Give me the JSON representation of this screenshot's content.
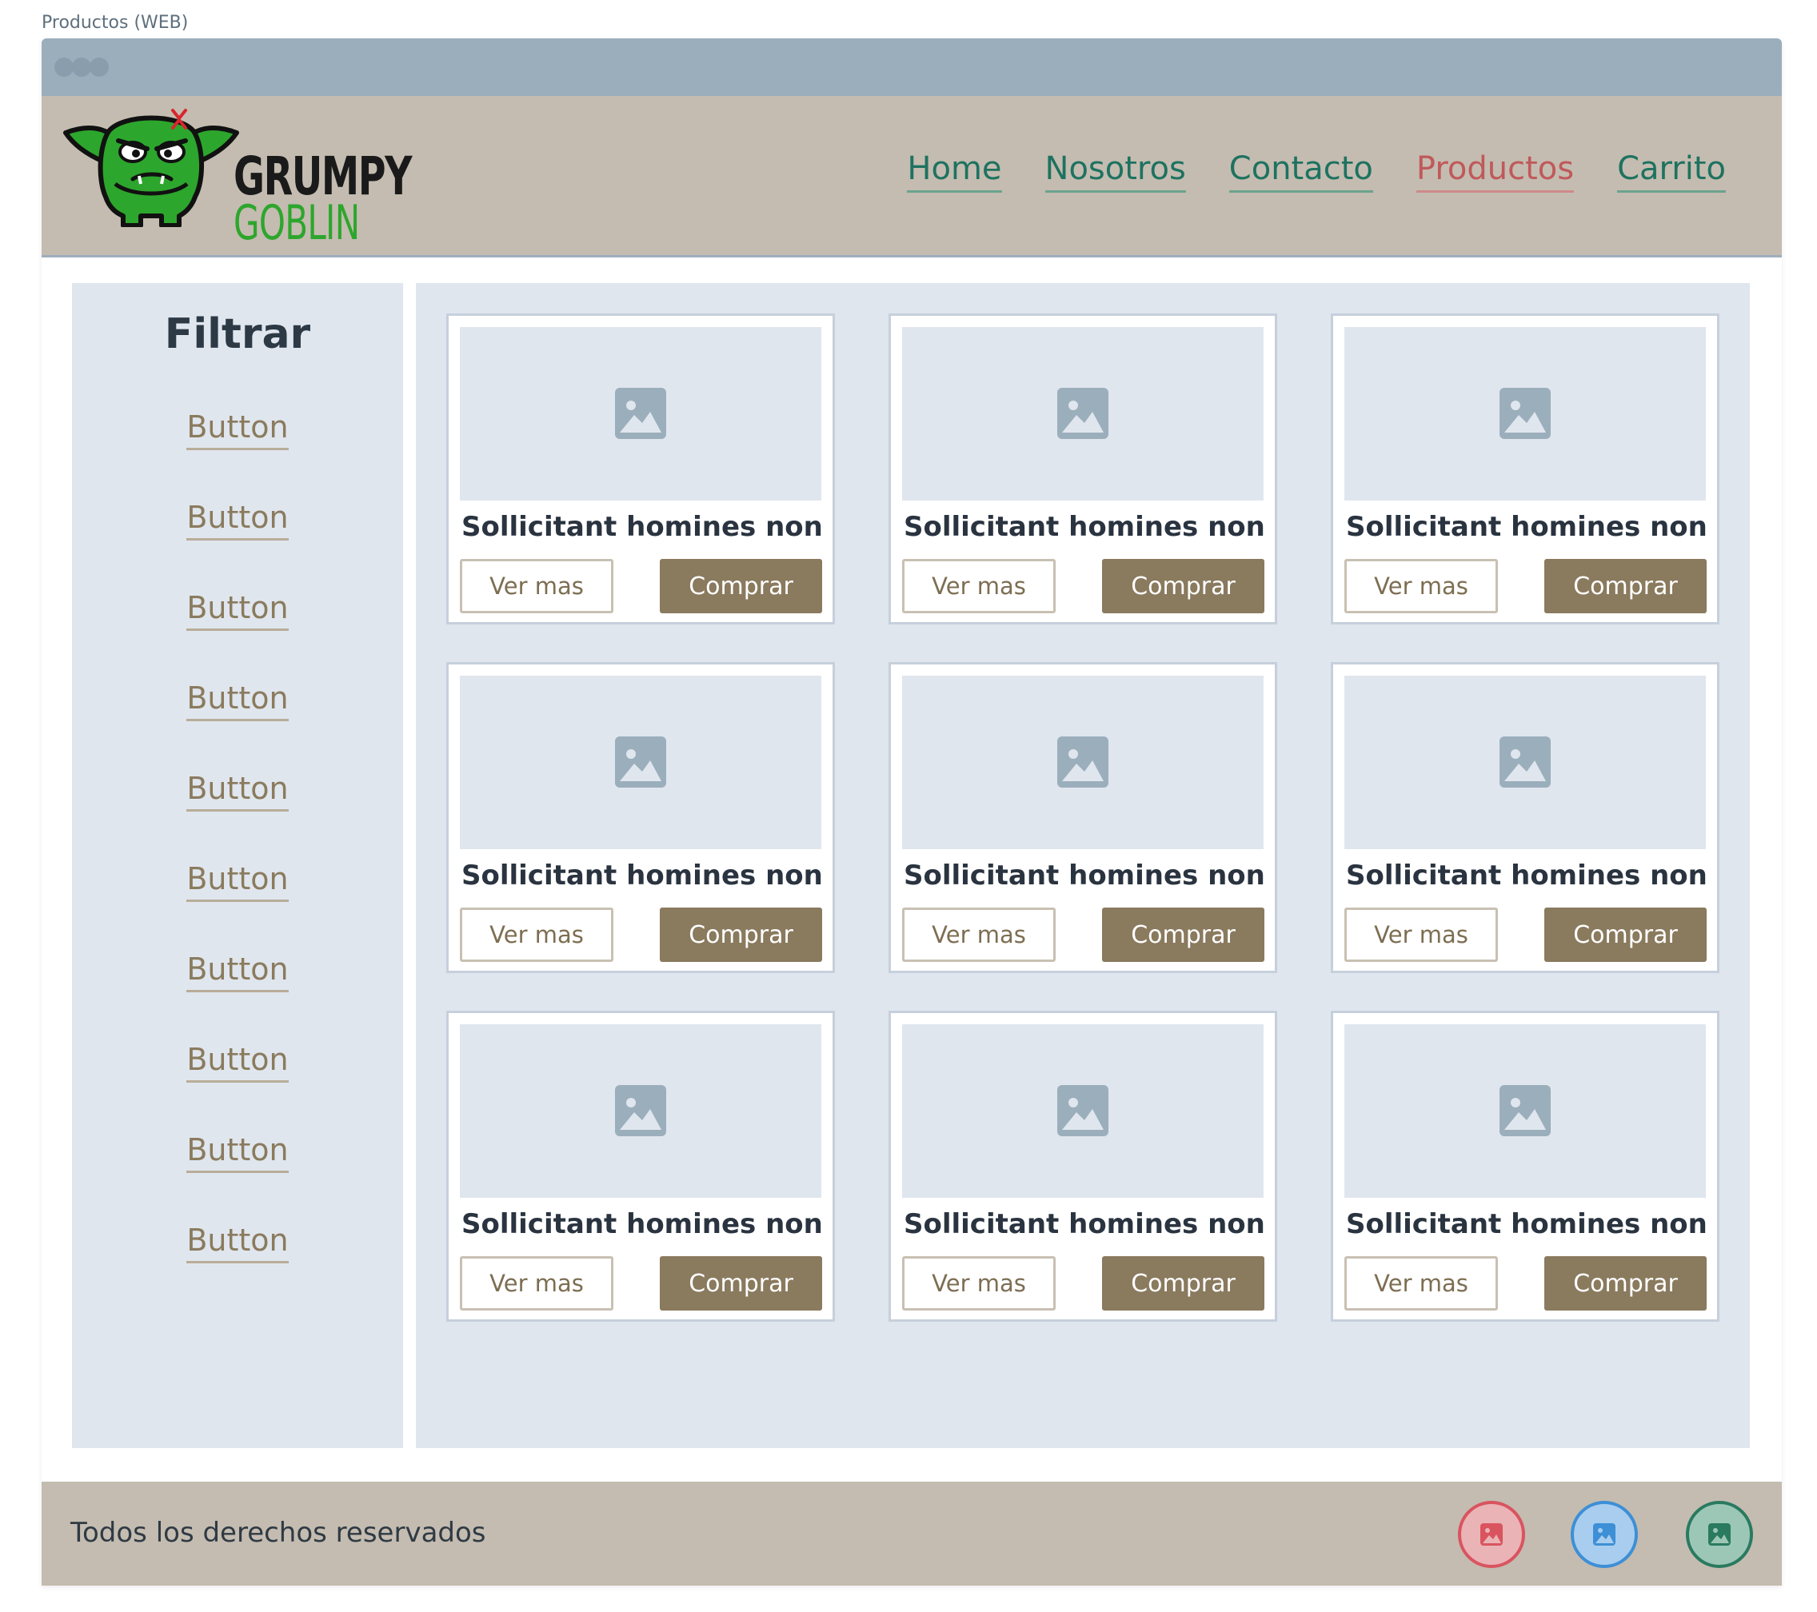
{
  "page_label": "Productos (WEB)",
  "logo": {
    "line1": "GRUMPY",
    "line2": "GOBLIN"
  },
  "nav": {
    "items": [
      {
        "label": "Home"
      },
      {
        "label": "Nosotros"
      },
      {
        "label": "Contacto"
      },
      {
        "label": "Productos",
        "active": true
      },
      {
        "label": "Carrito"
      }
    ]
  },
  "sidebar": {
    "title": "Filtrar",
    "buttons": [
      "Button",
      "Button",
      "Button",
      "Button",
      "Button",
      "Button",
      "Button",
      "Button",
      "Button",
      "Button"
    ]
  },
  "products": [
    {
      "title": "Sollicitant homines non",
      "view_label": "Ver mas",
      "buy_label": "Comprar"
    },
    {
      "title": "Sollicitant homines non",
      "view_label": "Ver mas",
      "buy_label": "Comprar"
    },
    {
      "title": "Sollicitant homines non",
      "view_label": "Ver mas",
      "buy_label": "Comprar"
    },
    {
      "title": "Sollicitant homines non",
      "view_label": "Ver mas",
      "buy_label": "Comprar"
    },
    {
      "title": "Sollicitant homines non",
      "view_label": "Ver mas",
      "buy_label": "Comprar"
    },
    {
      "title": "Sollicitant homines non",
      "view_label": "Ver mas",
      "buy_label": "Comprar"
    },
    {
      "title": "Sollicitant homines non",
      "view_label": "Ver mas",
      "buy_label": "Comprar"
    },
    {
      "title": "Sollicitant homines non",
      "view_label": "Ver mas",
      "buy_label": "Comprar"
    },
    {
      "title": "Sollicitant homines non",
      "view_label": "Ver mas",
      "buy_label": "Comprar"
    }
  ],
  "footer": {
    "text": "Todos los derechos reservados",
    "social": [
      {
        "icon": "image-icon",
        "color": "#d9545f"
      },
      {
        "icon": "image-icon",
        "color": "#3d8fd6"
      },
      {
        "icon": "image-icon",
        "color": "#2a7a60"
      }
    ]
  },
  "colors": {
    "titlebar": "#9baebc",
    "header_bg": "#c4bcb0",
    "nav_link": "#1e7260",
    "nav_active": "#c0595a",
    "panel_bg": "#e0e6ee",
    "buy_button": "#8a7a5e",
    "logo_green": "#2da62d"
  }
}
